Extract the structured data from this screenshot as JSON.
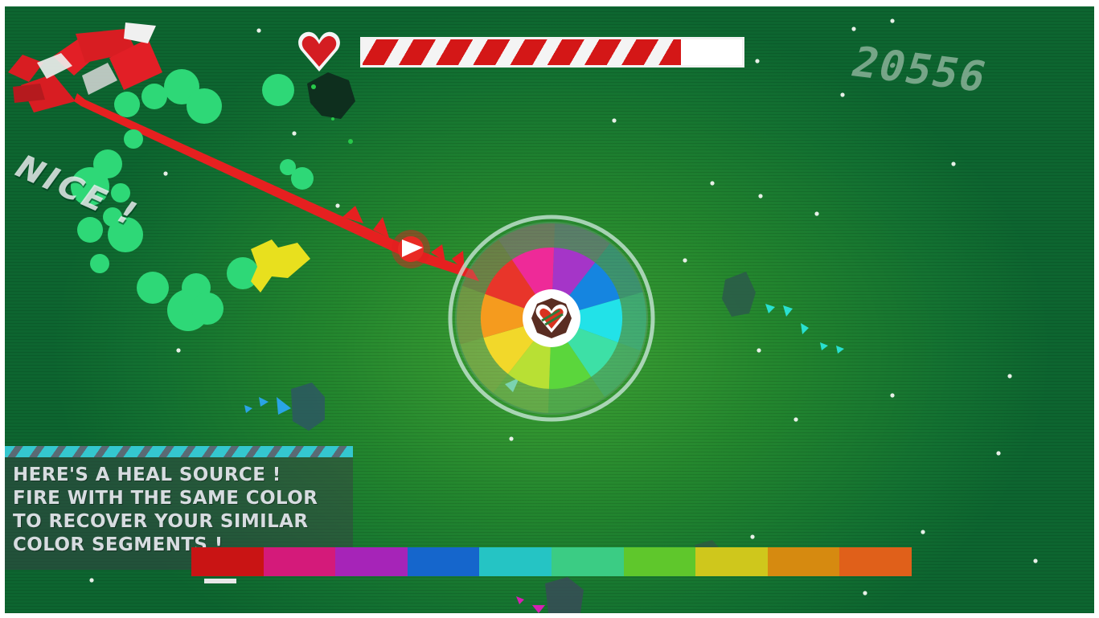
{
  "hud": {
    "score": "20556",
    "combo_message": "NICE !",
    "health_fraction": 0.84,
    "health_colors": {
      "stripe_a": "#d41717",
      "stripe_b": "#f4f4f4"
    }
  },
  "tutorial": {
    "lines": [
      "HERE'S A HEAL SOURCE !",
      "FIRE WITH THE SAME COLOR",
      "TO RECOVER YOUR SIMILAR",
      "COLOR SEGMENTS !"
    ]
  },
  "color_bar": {
    "segments": [
      "#c91414",
      "#d41a7a",
      "#a624b8",
      "#1566cc",
      "#25c4c4",
      "#3bcc84",
      "#5fc72c",
      "#cfc71c",
      "#d68a10",
      "#e0601a"
    ]
  },
  "wheel": {
    "segments": [
      "#e8352a",
      "#ee2a98",
      "#a535c8",
      "#1585e0",
      "#22e2e8",
      "#3de0a6",
      "#5bd63c",
      "#b8e034",
      "#f2d82a",
      "#f59b1e"
    ]
  },
  "icons": {
    "health": "heart-icon",
    "core": "striped-heart-icon",
    "cursor": "arrow-cursor-icon"
  }
}
